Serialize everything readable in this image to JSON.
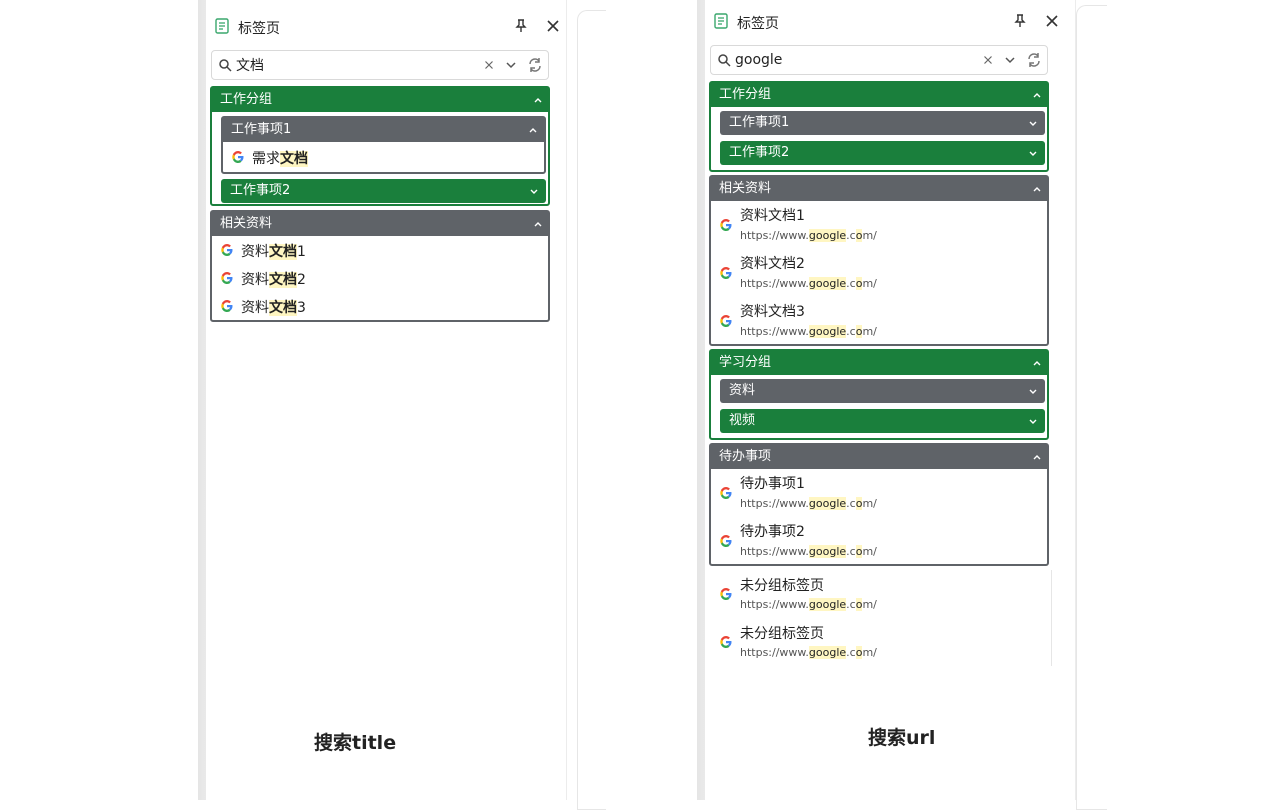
{
  "panels": {
    "left": {
      "title": "标签页",
      "search_value": "文档",
      "groups": {
        "work": {
          "label": "工作分组",
          "sub1": {
            "label": "工作事项1",
            "item_prefix": "需求",
            "item_match": "文档"
          },
          "sub2": {
            "label": "工作事项2"
          }
        },
        "ref": {
          "label": "相关资料",
          "items": [
            {
              "prefix": "资料",
              "match": "文档",
              "suffix": "1"
            },
            {
              "prefix": "资料",
              "match": "文档",
              "suffix": "2"
            },
            {
              "prefix": "资料",
              "match": "文档",
              "suffix": "3"
            }
          ]
        }
      },
      "caption": "搜索title"
    },
    "right": {
      "title": "标签页",
      "search_value": "google",
      "url": {
        "pre": "https://www.",
        "m1": "google",
        "mid": ".c",
        "m2": "o",
        "post": "m/"
      },
      "groups": {
        "work": {
          "label": "工作分组",
          "sub1": "工作事项1",
          "sub2": "工作事项2"
        },
        "ref": {
          "label": "相关资料",
          "items": [
            "资料文档1",
            "资料文档2",
            "资料文档3"
          ]
        },
        "study": {
          "label": "学习分组",
          "sub1": "资料",
          "sub2": "视频"
        },
        "todo": {
          "label": "待办事项",
          "items": [
            "待办事项1",
            "待办事项2"
          ]
        }
      },
      "ungrouped": [
        "未分组标签页",
        "未分组标签页"
      ],
      "caption": "搜索url"
    }
  },
  "colors": {
    "green": "#1a7f3c",
    "gray": "#5f6368",
    "highlight": "#fff6c2"
  },
  "icons": [
    "doc-icon",
    "pin-icon",
    "close-icon",
    "search-icon",
    "clear-icon",
    "chevron-down-icon",
    "sync-icon",
    "chevron-up-icon",
    "google-icon"
  ]
}
